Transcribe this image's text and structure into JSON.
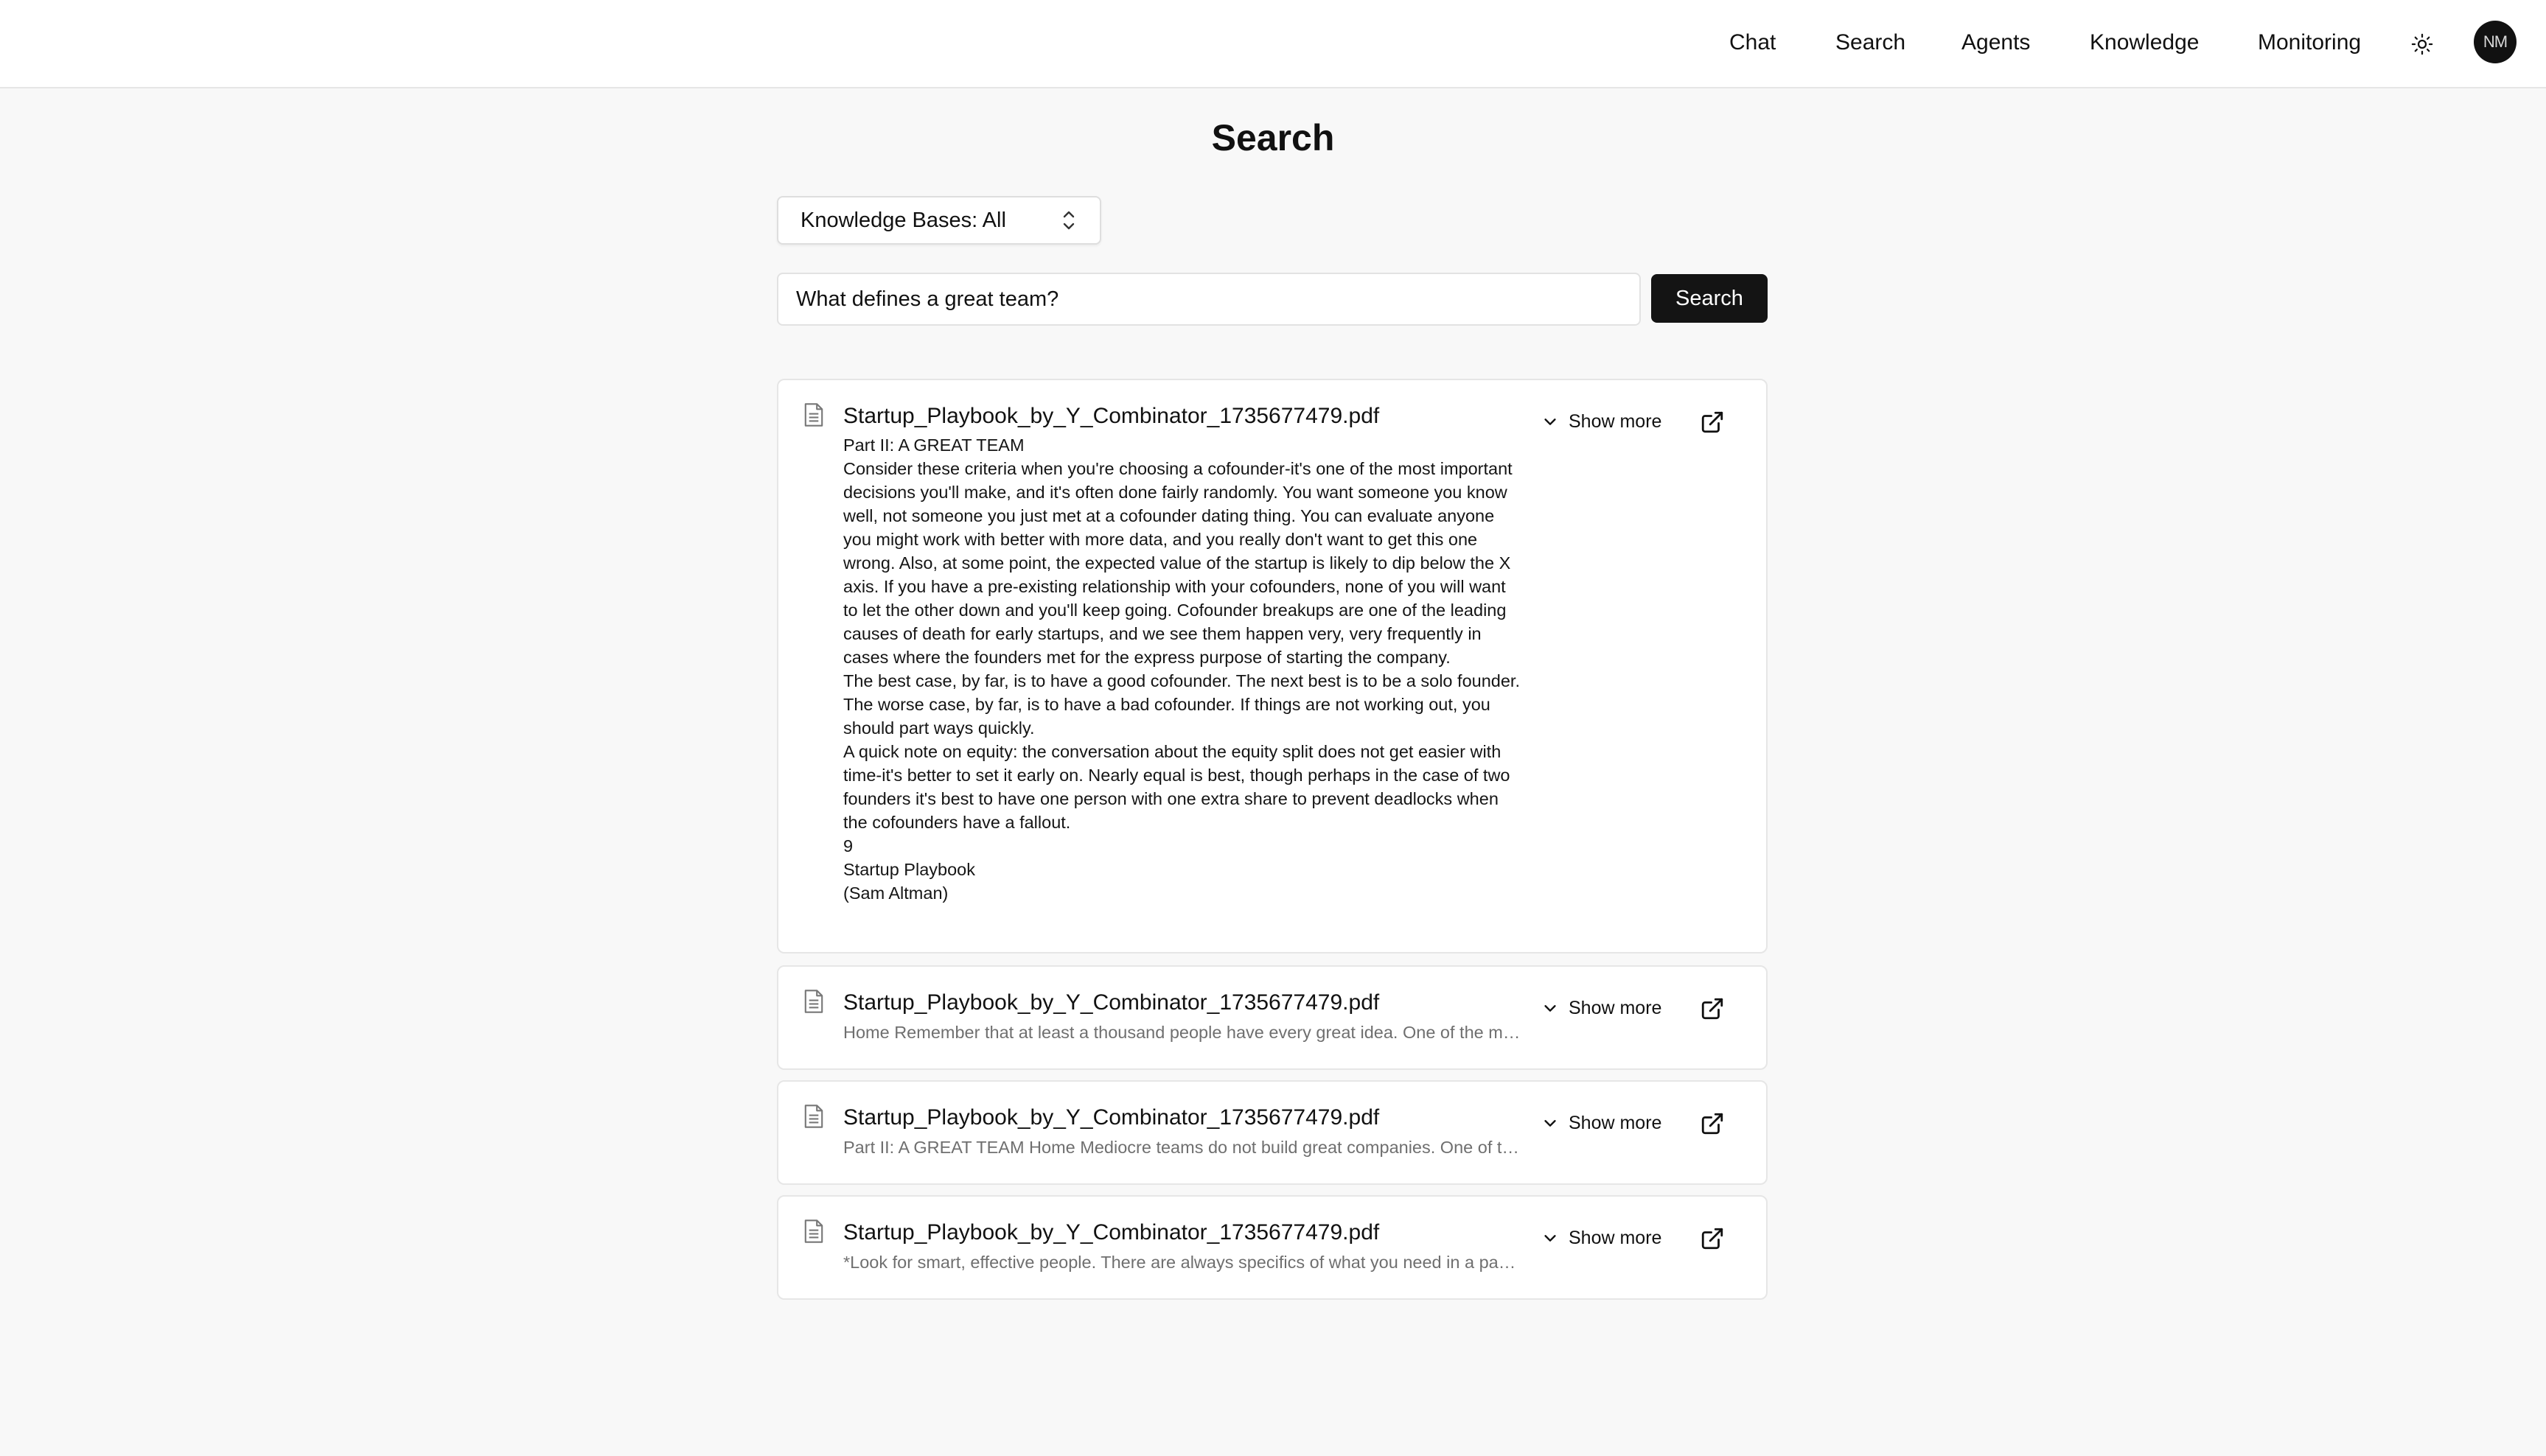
{
  "nav": {
    "items": [
      {
        "label": "Chat"
      },
      {
        "label": "Search"
      },
      {
        "label": "Agents"
      },
      {
        "label": "Knowledge"
      },
      {
        "label": "Monitoring"
      }
    ],
    "theme_icon": "sun-icon",
    "avatar_initials": "NM"
  },
  "page": {
    "title": "Search"
  },
  "kb_selector": {
    "label": "Knowledge Bases: All",
    "icon": "chevron-up-down-icon"
  },
  "search": {
    "query": "What defines a great team?",
    "button_label": "Search"
  },
  "results": [
    {
      "title": "Startup_Playbook_by_Y_Combinator_1735677479.pdf",
      "expanded": true,
      "lines": [
        "Part II: A GREAT TEAM",
        "Consider these criteria when you're choosing a cofounder-it's one of the most important decisions you'll make, and it's often done fairly randomly. You want someone you know well, not someone you just met at a cofounder dating thing. You can evaluate anyone you might work with better with more data, and you really don't want to get this one wrong. Also, at some point, the expected value of the startup is likely to dip below the X axis. If you have a pre-existing relationship with your cofounders, none of you will want to let the other down and you'll keep going. Cofounder breakups are one of the leading causes of death for early startups, and we see them happen very, very frequently in cases where the founders met for the express purpose of starting the company.",
        "The best case, by far, is to have a good cofounder. The next best is to be a solo founder. The worse case, by far, is to have a bad cofounder. If things are not working out, you should part ways quickly.",
        "A quick note on equity: the conversation about the equity split does not get easier with time-it's better to set it early on. Nearly equal is best, though perhaps in the case of two founders it's best to have one person with one extra share to prevent deadlocks when the cofounders have a fallout.",
        "9",
        "Startup Playbook",
        "(Sam Altman)"
      ],
      "show_more_label": "Show more"
    },
    {
      "title": "Startup_Playbook_by_Y_Combinator_1735677479.pdf",
      "expanded": false,
      "snippet": "Home Remember that at least a thousand people have every great idea. One of the most important things for a startup is",
      "show_more_label": "Show more"
    },
    {
      "title": "Startup_Playbook_by_Y_Combinator_1735677479.pdf",
      "expanded": false,
      "snippet": "Part II: A GREAT TEAM Home Mediocre teams do not build great companies. One of the things we look at the most",
      "show_more_label": "Show more"
    },
    {
      "title": "Startup_Playbook_by_Y_Combinator_1735677479.pdf",
      "expanded": false,
      "snippet": "*Look for smart, effective people. There are always specifics of what you need in a particular role, but these",
      "show_more_label": "Show more"
    }
  ]
}
